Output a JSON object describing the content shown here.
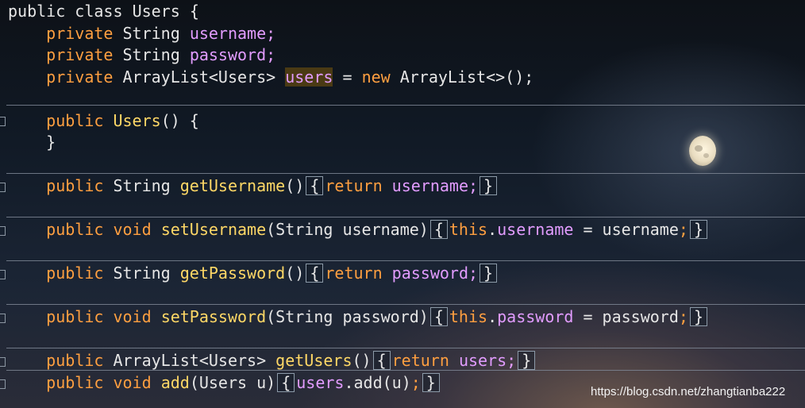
{
  "code": {
    "l1": {
      "kw1": "public",
      "kw2": "class",
      "name": "Users",
      "open": "{"
    },
    "l2": {
      "kw": "private",
      "type": "String",
      "field": "username;"
    },
    "l3": {
      "kw": "private",
      "type": "String",
      "field": "password;"
    },
    "l4": {
      "kw": "private",
      "type": "ArrayList<Users>",
      "field": "users",
      "eq": " = ",
      "new": "new",
      "rest": " ArrayList<>();"
    },
    "l5": {
      "kw": "public",
      "name": "Users",
      "rest": "() {"
    },
    "l6": {
      "close": "}"
    },
    "l7": {
      "kw": "public",
      "type": "String",
      "fn": "getUsername",
      "paren": "()",
      "ob": "{",
      "ret": "return",
      "field": "username;",
      "cb": "}"
    },
    "l8": {
      "kw": "public",
      "void": "void",
      "fn": "setUsername",
      "params": "(String username)",
      "ob": "{",
      "this": "this",
      "dot": ".",
      "field": "username",
      "assign": " = username",
      "semi": ";",
      "cb": "}"
    },
    "l9": {
      "kw": "public",
      "type": "String",
      "fn": "getPassword",
      "paren": "()",
      "ob": "{",
      "ret": "return",
      "field": "password;",
      "cb": "}"
    },
    "l10": {
      "kw": "public",
      "void": "void",
      "fn": "setPassword",
      "params": "(String password)",
      "ob": "{",
      "this": "this",
      "dot": ".",
      "field": "password",
      "assign": " = password",
      "semi": ";",
      "cb": "}"
    },
    "l11": {
      "kw": "public",
      "type": "ArrayList<Users>",
      "fn": "getUsers",
      "paren": "()",
      "ob": "{",
      "ret": "return",
      "field": "users;",
      "cb": "}"
    },
    "l12": {
      "kw": "public",
      "void": "void",
      "fn": "add",
      "params": "(Users u)",
      "ob": "{",
      "field": "users",
      "call": ".add(u)",
      "semi": ";",
      "cb": "}"
    }
  },
  "watermark": "https://blog.csdn.net/zhangtianba222",
  "colors": {
    "keyword": "#ff9f40",
    "field": "#e29cff",
    "method": "#ffd866",
    "text": "#e6e6e6",
    "highlight": "#4a3a14"
  }
}
